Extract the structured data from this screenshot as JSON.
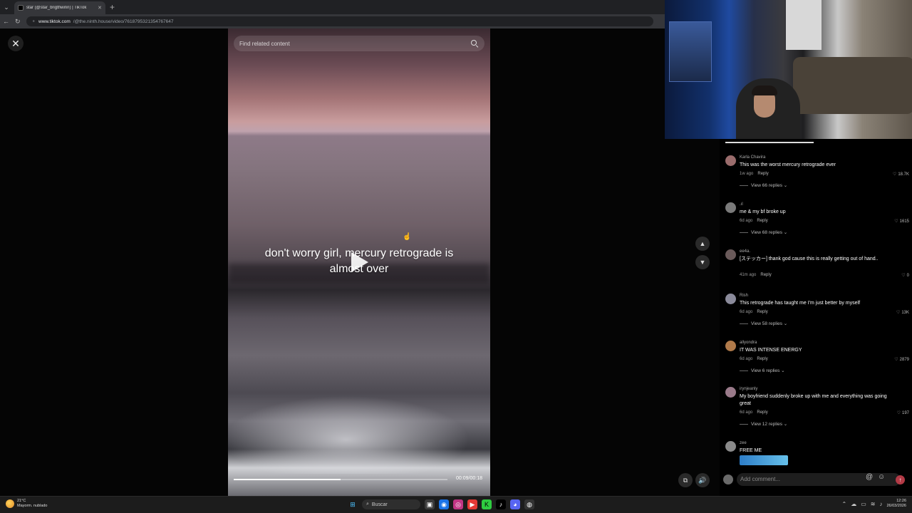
{
  "browser": {
    "tab_title": "star (@star_brigthwinn) | TikTok",
    "url_host": "www.tiktok.com",
    "url_path": "/@the.ninth.house/video/7618795321354767647"
  },
  "video": {
    "search_placeholder": "Find related content",
    "caption": "don't worry girl, mercury retrograde is almost over",
    "timecode": "00:09/00:18",
    "progress": 0.5
  },
  "comments": [
    {
      "user": "Karla Chavira",
      "text": "This was the worst mercury retrograde ever",
      "time": "1w ago",
      "likes": "18.7K",
      "views": "View 66 replies",
      "avatar_color": "#9a6c6c"
    },
    {
      "user": ".ıl",
      "text": "me & my bf broke up",
      "time": "6d ago",
      "likes": "1615",
      "views": "View 68 replies",
      "avatar_color": "#7a7a7a"
    },
    {
      "user": "ee4a.",
      "text": "[ステッカー] thank god cause this is really getting out of hand..",
      "time": "41m ago",
      "likes": "0",
      "views": "",
      "avatar_color": "#6a5a5a"
    },
    {
      "user": "Rish",
      "text": "This retrograde has taught me I'm just better by myself",
      "time": "6d ago",
      "likes": "13K",
      "views": "View 58 replies",
      "avatar_color": "#8a8a9a"
    },
    {
      "user": "allyondra",
      "text": "IT WAS INTENSE ENERGY",
      "time": "6d ago",
      "likes": "2879",
      "views": "View 6 replies",
      "avatar_color": "#b07a4a"
    },
    {
      "user": "irynjeanly",
      "text": "My boyfriend suddenly broke up with me and everything was going great",
      "time": "6d ago",
      "likes": "197",
      "views": "View 12 replies",
      "avatar_color": "#9a7a8a"
    },
    {
      "user": "zee",
      "text": "FREE ME",
      "time": "",
      "likes": "",
      "views": "",
      "avatar_color": "#8a8a8a"
    }
  ],
  "composer": {
    "placeholder": "Add comment..."
  },
  "taskbar": {
    "temp": "21°C",
    "weather": "Mayorm. nublado",
    "search": "Buscar",
    "time": "12:26",
    "date": "26/03/2026"
  },
  "labels": {
    "reply": "Reply"
  }
}
